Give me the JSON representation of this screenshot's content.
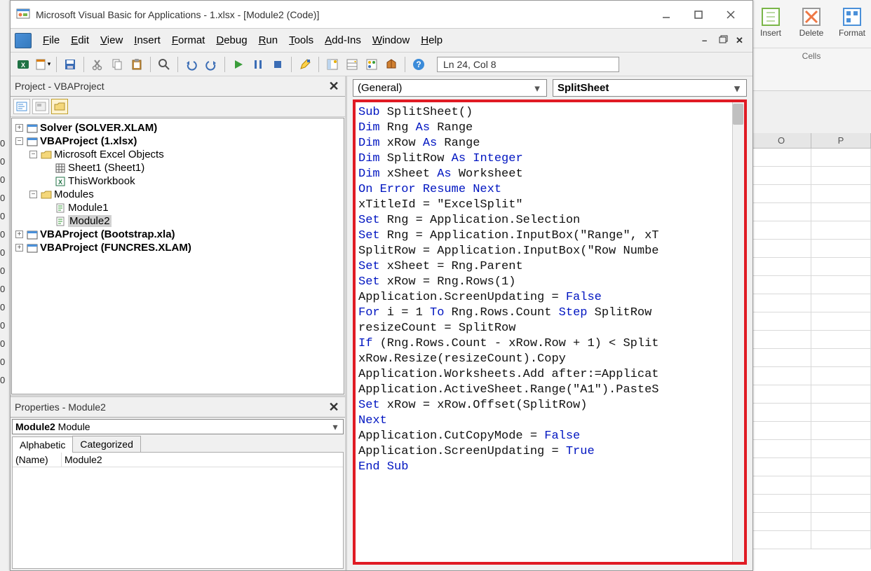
{
  "excel": {
    "ribbon": {
      "buttons": [
        "Insert",
        "Delete",
        "Format"
      ],
      "group": "Cells"
    },
    "columns": [
      "O",
      "P"
    ]
  },
  "titlebar": {
    "title": "Microsoft Visual Basic for Applications - 1.xlsx - [Module2 (Code)]"
  },
  "menus": [
    "File",
    "Edit",
    "View",
    "Insert",
    "Format",
    "Debug",
    "Run",
    "Tools",
    "Add-Ins",
    "Window",
    "Help"
  ],
  "toolbar": {
    "cursor_pos": "Ln 24, Col 8"
  },
  "project_pane": {
    "title": "Project - VBAProject",
    "tree": {
      "solver": "Solver (SOLVER.XLAM)",
      "proj1": "VBAProject (1.xlsx)",
      "objects": "Microsoft Excel Objects",
      "sheet1": "Sheet1 (Sheet1)",
      "thiswb": "ThisWorkbook",
      "modules": "Modules",
      "module1": "Module1",
      "module2": "Module2",
      "bootstrap": "VBAProject (Bootstrap.xla)",
      "funcres": "VBAProject (FUNCRES.XLAM)"
    }
  },
  "properties_pane": {
    "title": "Properties - Module2",
    "combo_name": "Module2",
    "combo_type": "Module",
    "tabs": [
      "Alphabetic",
      "Categorized"
    ],
    "name_label": "(Name)",
    "name_value": "Module2"
  },
  "code_pane": {
    "combo_left": "(General)",
    "combo_right": "SplitSheet",
    "code_tokens": [
      [
        [
          "kw",
          "Sub"
        ],
        [
          "",
          " SplitSheet()"
        ]
      ],
      [
        [
          "kw",
          "Dim"
        ],
        [
          "",
          " Rng "
        ],
        [
          "kw",
          "As"
        ],
        [
          "",
          " Range"
        ]
      ],
      [
        [
          "kw",
          "Dim"
        ],
        [
          "",
          " xRow "
        ],
        [
          "kw",
          "As"
        ],
        [
          "",
          " Range"
        ]
      ],
      [
        [
          "kw",
          "Dim"
        ],
        [
          "",
          " SplitRow "
        ],
        [
          "kw",
          "As"
        ],
        [
          "",
          " "
        ],
        [
          "kw",
          "Integer"
        ]
      ],
      [
        [
          "kw",
          "Dim"
        ],
        [
          "",
          " xSheet "
        ],
        [
          "kw",
          "As"
        ],
        [
          "",
          " Worksheet"
        ]
      ],
      [
        [
          "kw",
          "On Error Resume Next"
        ]
      ],
      [
        [
          "",
          "xTitleId = \"ExcelSplit\""
        ]
      ],
      [
        [
          "kw",
          "Set"
        ],
        [
          "",
          " Rng = Application.Selection"
        ]
      ],
      [
        [
          "kw",
          "Set"
        ],
        [
          "",
          " Rng = Application.InputBox(\"Range\", xT"
        ]
      ],
      [
        [
          "",
          "SplitRow = Application.InputBox(\"Row Numbe"
        ]
      ],
      [
        [
          "kw",
          "Set"
        ],
        [
          "",
          " xSheet = Rng.Parent"
        ]
      ],
      [
        [
          "kw",
          "Set"
        ],
        [
          "",
          " xRow = Rng.Rows(1)"
        ]
      ],
      [
        [
          "",
          "Application.ScreenUpdating = "
        ],
        [
          "kw",
          "False"
        ]
      ],
      [
        [
          "kw",
          "For"
        ],
        [
          "",
          " i = 1 "
        ],
        [
          "kw",
          "To"
        ],
        [
          "",
          " Rng.Rows.Count "
        ],
        [
          "kw",
          "Step"
        ],
        [
          "",
          " SplitRow"
        ]
      ],
      [
        [
          "",
          "resizeCount = SplitRow"
        ]
      ],
      [
        [
          "kw",
          "If"
        ],
        [
          "",
          " (Rng.Rows.Count - xRow.Row + 1) < Split"
        ]
      ],
      [
        [
          "",
          "xRow.Resize(resizeCount).Copy"
        ]
      ],
      [
        [
          "",
          "Application.Worksheets.Add after:=Applicat"
        ]
      ],
      [
        [
          "",
          "Application.ActiveSheet.Range(\"A1\").PasteS"
        ]
      ],
      [
        [
          "kw",
          "Set"
        ],
        [
          "",
          " xRow = xRow.Offset(SplitRow)"
        ]
      ],
      [
        [
          "kw",
          "Next"
        ]
      ],
      [
        [
          "",
          "Application.CutCopyMode = "
        ],
        [
          "kw",
          "False"
        ]
      ],
      [
        [
          "",
          "Application.ScreenUpdating = "
        ],
        [
          "kw",
          "True"
        ]
      ],
      [
        [
          "kw",
          "End Sub"
        ]
      ]
    ]
  }
}
